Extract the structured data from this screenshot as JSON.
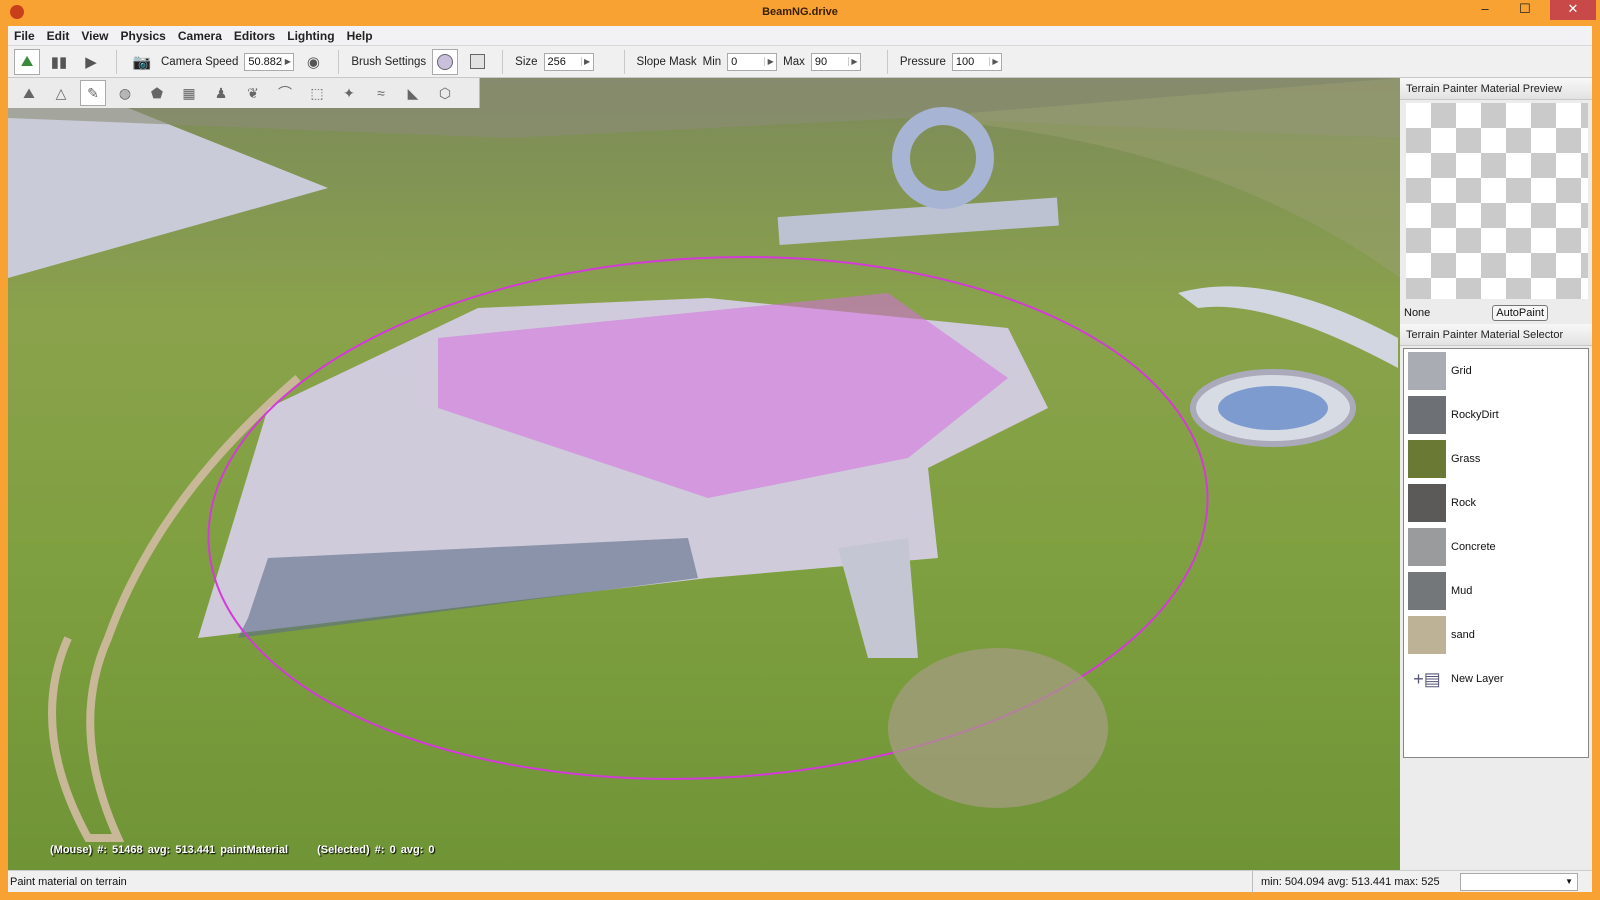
{
  "window": {
    "title": "BeamNG.drive",
    "minimize": "‒",
    "maximize": "☐",
    "close": "✕"
  },
  "menu": [
    "File",
    "Edit",
    "View",
    "Physics",
    "Camera",
    "Editors",
    "Lighting",
    "Help"
  ],
  "toolbar": {
    "camera_speed_label": "Camera Speed",
    "camera_speed": "50.882",
    "brush_settings_label": "Brush Settings",
    "size_label": "Size",
    "size": "256",
    "slope_mask_label": "Slope Mask",
    "min_label": "Min",
    "min": "0",
    "max_label": "Max",
    "max": "90",
    "pressure_label": "Pressure",
    "pressure": "100"
  },
  "preview": {
    "title": "Terrain Painter Material Preview",
    "material": "None",
    "autopaint": "AutoPaint"
  },
  "selector": {
    "title": "Terrain Painter Material Selector",
    "materials": [
      {
        "name": "Grid",
        "color": "#a9acb2"
      },
      {
        "name": "RockyDirt",
        "color": "#6d7075"
      },
      {
        "name": "Grass",
        "color": "#6a7a34"
      },
      {
        "name": "Rock",
        "color": "#5c5a58"
      },
      {
        "name": "Concrete",
        "color": "#9a9b9d"
      },
      {
        "name": "Mud",
        "color": "#74777a"
      },
      {
        "name": "sand",
        "color": "#bdb296"
      }
    ],
    "new_layer": "New Layer"
  },
  "overlay": {
    "mouse": "(Mouse) #: 51468  avg: 513.441  paintMaterial",
    "selected": "(Selected) #: 0  avg: 0"
  },
  "status": {
    "message": "Paint material on terrain",
    "stats": "min: 504.094  avg: 513.441  max: 525"
  }
}
